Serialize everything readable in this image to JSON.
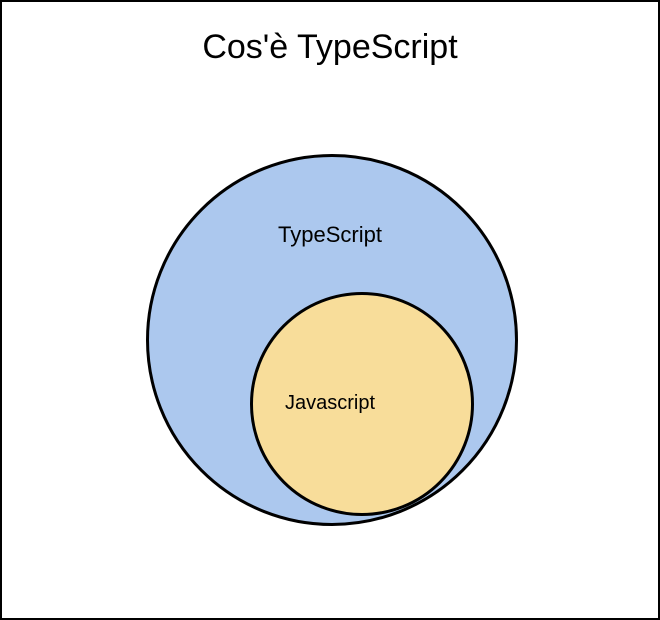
{
  "title": "Cos'è TypeScript",
  "outer": {
    "label": "TypeScript",
    "colors": {
      "fill": "#acc8ee",
      "stroke": "#000000"
    }
  },
  "inner": {
    "label": "Javascript",
    "colors": {
      "fill": "#f8dd9a",
      "stroke": "#000000"
    }
  }
}
